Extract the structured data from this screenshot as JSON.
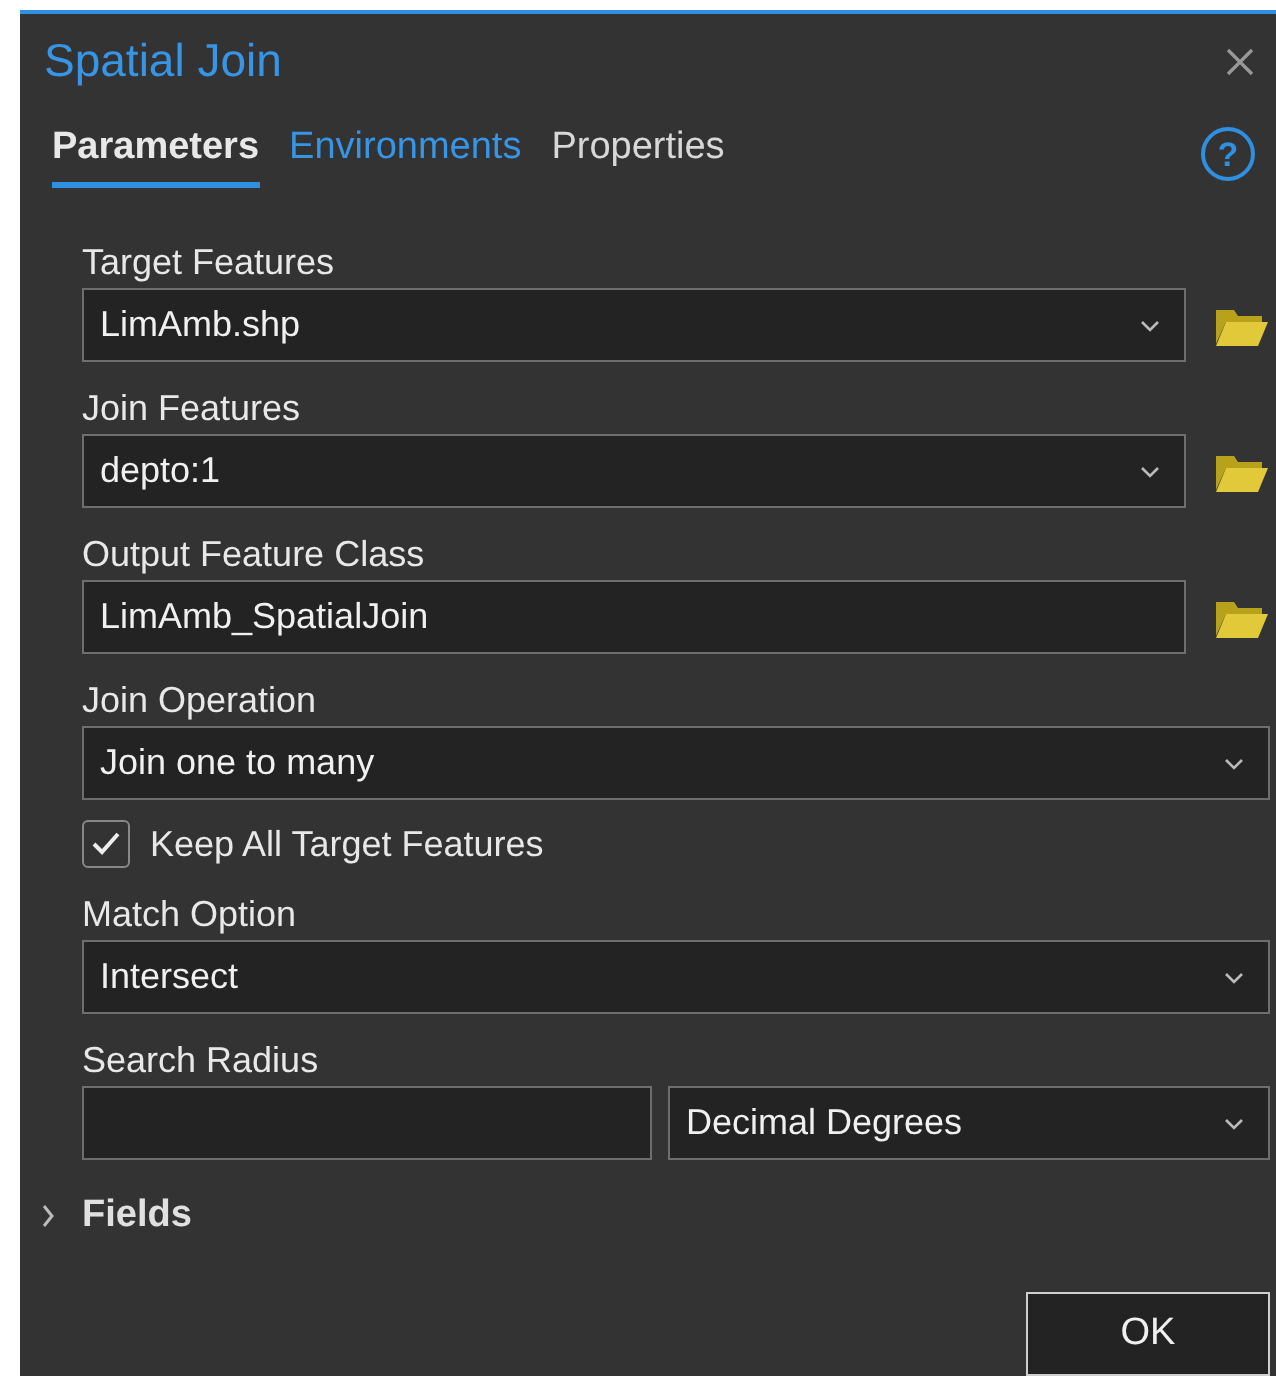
{
  "window": {
    "title": "Spatial Join"
  },
  "tabs": [
    {
      "label": "Parameters",
      "selected": true,
      "hovered": false
    },
    {
      "label": "Environments",
      "selected": false,
      "hovered": true
    },
    {
      "label": "Properties",
      "selected": false,
      "hovered": false
    }
  ],
  "parameters": [
    {
      "kind": "dropdown",
      "label": "Target Features",
      "value": "LimAmb.shp",
      "browse": true
    },
    {
      "kind": "dropdown",
      "label": "Join Features",
      "value": "depto:1",
      "browse": true
    },
    {
      "kind": "text",
      "label": "Output Feature Class",
      "value": "LimAmb_SpatialJoin",
      "browse": true
    },
    {
      "kind": "dropdown",
      "label": "Join Operation",
      "value": "Join one to many",
      "browse": false
    },
    {
      "kind": "checkbox",
      "label": "Keep All Target Features",
      "checked": true
    },
    {
      "kind": "dropdown",
      "label": "Match Option",
      "value": "Intersect",
      "browse": false
    },
    {
      "kind": "distance",
      "label": "Search Radius",
      "unit": "Decimal Degrees"
    }
  ],
  "section": {
    "label": "Fields",
    "expanded": false
  },
  "help": {
    "glyph": "?"
  },
  "buttons": [
    "OK"
  ]
}
